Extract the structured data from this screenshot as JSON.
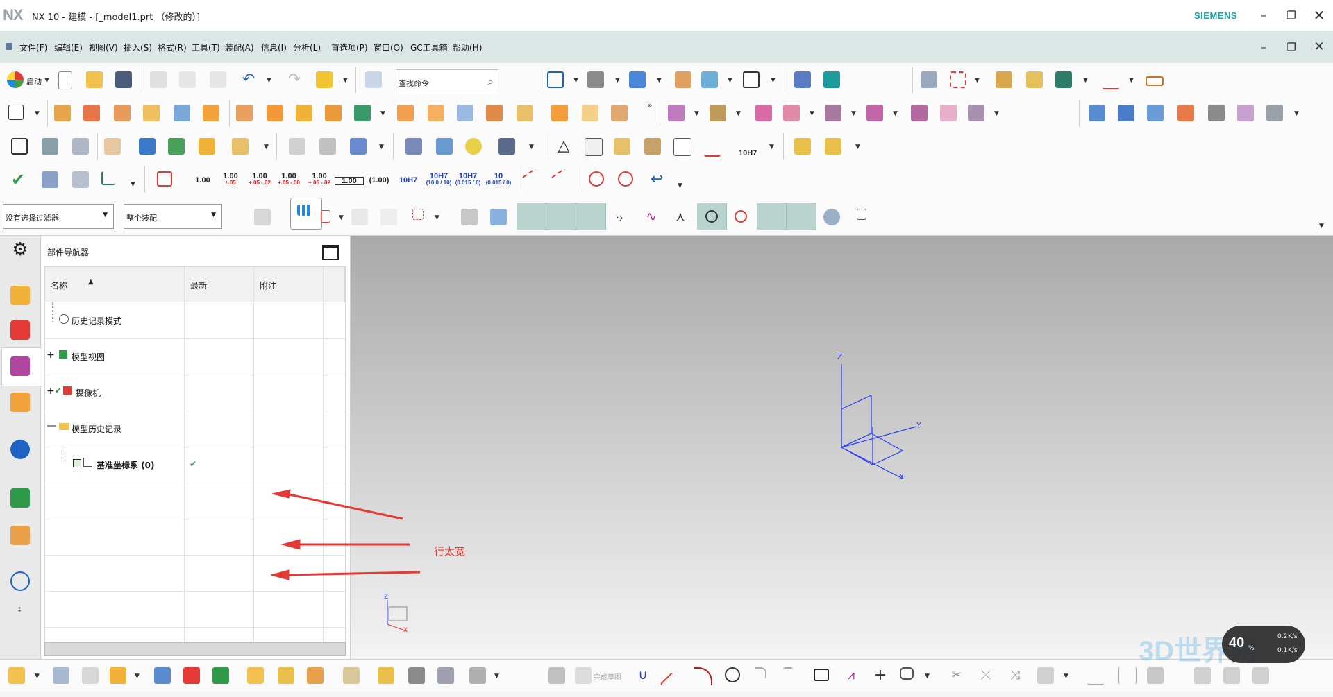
{
  "window": {
    "logo": "NX",
    "title": "NX 10 - 建模 - [_model1.prt （修改的）]",
    "brand": "SIEMENS"
  },
  "menu": [
    "文件(F)",
    "编辑(E)",
    "视图(V)",
    "插入(S)",
    "格式(R)",
    "工具(T)",
    "装配(A)",
    "信息(I)",
    "分析(L)",
    "首选项(P)",
    "窗口(O)",
    "GC工具箱",
    "帮助(H)"
  ],
  "toolbar": {
    "start_label": "启动",
    "search_placeholder": "查找命令",
    "overflow": "»",
    "dims": [
      {
        "main": "1.00",
        "sub": ""
      },
      {
        "main": "1.00",
        "sub": "±.05"
      },
      {
        "main": "1.00",
        "sub": "+.05 -.02"
      },
      {
        "main": "1.00",
        "sub": "+.05 -.00"
      },
      {
        "main": "1.00",
        "sub": "+.05 -.02"
      },
      {
        "main": "1.00",
        "sub": ""
      },
      {
        "main": "(1.00)",
        "sub": ""
      },
      {
        "main": "10H7",
        "sub": ""
      },
      {
        "main": "10H7",
        "sub": "(10.0 / 10)"
      },
      {
        "main": "10H7",
        "sub": "(0.015 / 0)"
      },
      {
        "main": "10",
        "sub": "(0.015 / 0)"
      }
    ],
    "fit_label": "10H7",
    "selection_filter": "没有选择过滤器",
    "assembly_scope": "整个装配"
  },
  "navigator": {
    "title": "部件导航器",
    "columns": [
      "名称",
      "最新",
      "附注"
    ],
    "nodes": [
      {
        "label": "历史记录模式",
        "latest": ""
      },
      {
        "label": "模型视图",
        "latest": ""
      },
      {
        "label": "摄像机",
        "latest": ""
      },
      {
        "label": "模型历史记录",
        "latest": ""
      },
      {
        "label": "基准坐标系 (0)",
        "latest": "✔"
      }
    ]
  },
  "graphics": {
    "axes": {
      "z": "Z",
      "y": "Y",
      "x": "X"
    },
    "annotation": "行太宽"
  },
  "bottom": {
    "finish_sketch": "完成草图",
    "speed_value": "40",
    "speed_unit": "%",
    "speed_up": "0.2",
    "speed_down": "0.1",
    "speed_unit_k": "K/s",
    "watermark": "3D世界网"
  },
  "colors": {
    "menu_bg": "#dce6e4",
    "accent": "#1aa0a0",
    "annotation": "#e53935",
    "axis": "#2b3cff"
  }
}
